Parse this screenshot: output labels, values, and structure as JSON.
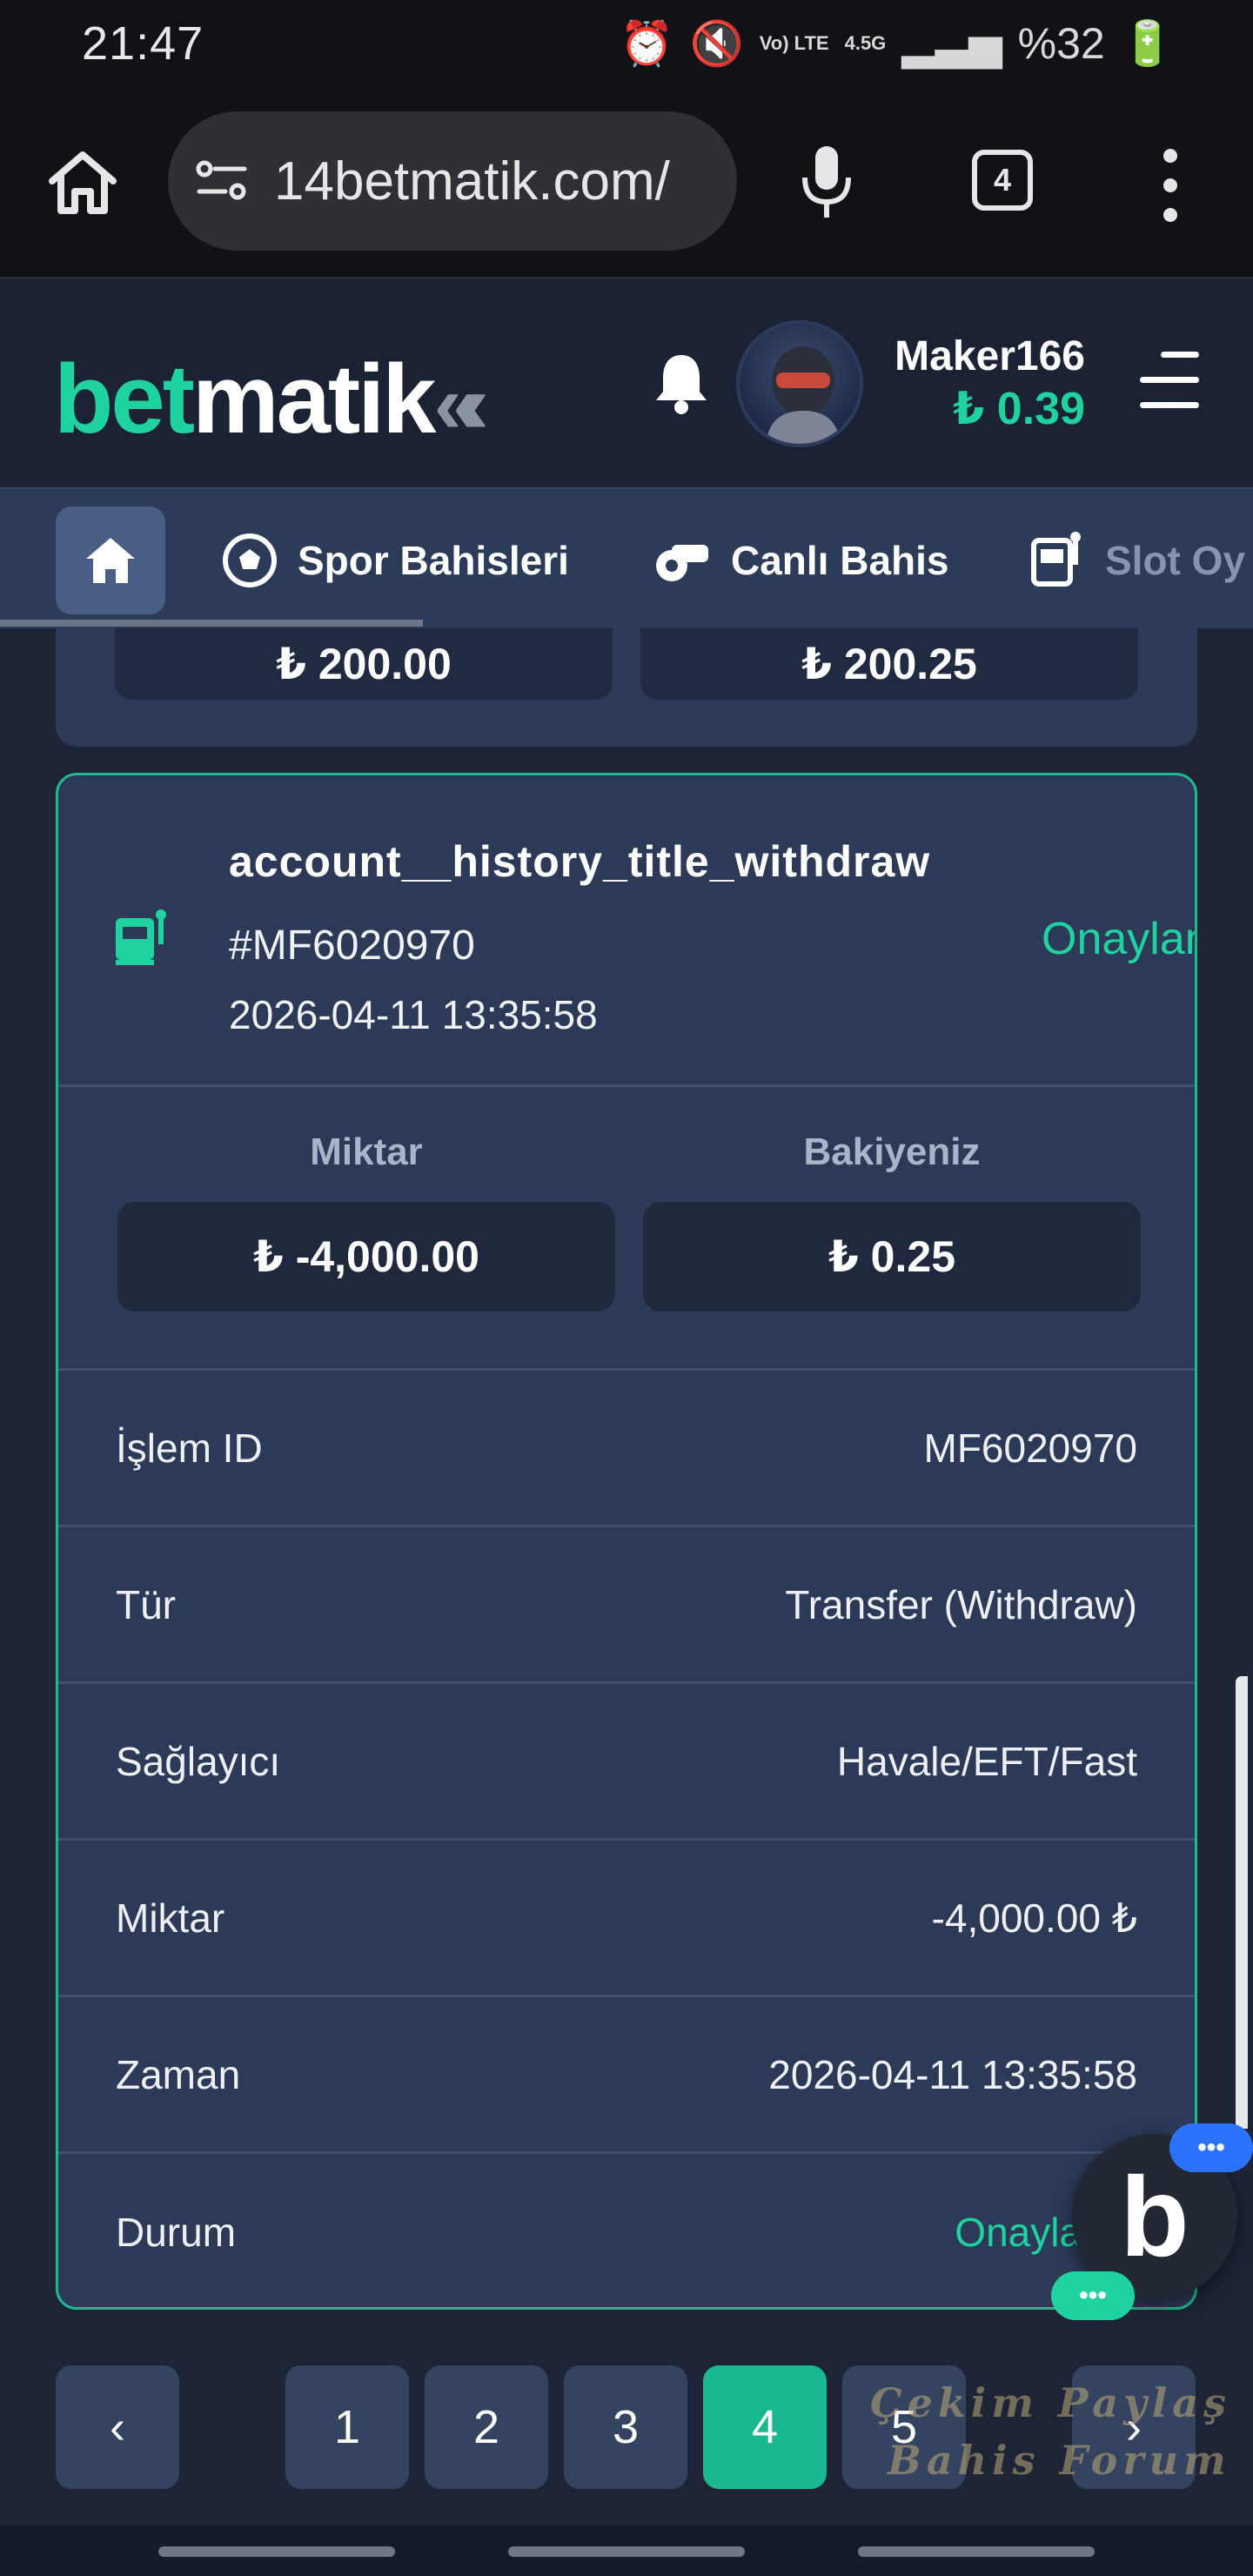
{
  "status_bar": {
    "time": "21:47",
    "network_top": "Vo) LTE",
    "network_speed": "4.5G",
    "battery": "%32"
  },
  "browser": {
    "url": "14betmatik.com/",
    "tab_count": "4"
  },
  "header": {
    "logo_bet": "bet",
    "logo_matik": "matik",
    "username": "Maker166",
    "balance": "₺ 0.39"
  },
  "nav": {
    "items": [
      {
        "label": "Spor Bahisleri"
      },
      {
        "label": "Canlı Bahis"
      },
      {
        "label": "Slot Oy"
      }
    ]
  },
  "previous_card": {
    "left_value": "₺ 200.00",
    "right_value": "₺ 200.25"
  },
  "transaction": {
    "title": "account__history_title_withdraw",
    "ref": "#MF6020970",
    "date": "2026-04-11 13:35:58",
    "status": "Onaylandı",
    "amount_label": "Miktar",
    "amount_value": "₺ -4,000.00",
    "balance_label": "Bakiyeniz",
    "balance_value": "₺ 0.25",
    "details": [
      {
        "key": "İşlem ID",
        "value": "MF6020970"
      },
      {
        "key": "Tür",
        "value": "Transfer (Withdraw)"
      },
      {
        "key": "Sağlayıcı",
        "value": "Havale/EFT/Fast"
      },
      {
        "key": "Miktar",
        "value": "-4,000.00 ₺"
      },
      {
        "key": "Zaman",
        "value": "2026-04-11 13:35:58"
      },
      {
        "key": "Durum",
        "value": "Onaylandı"
      }
    ]
  },
  "chat": {
    "badge_letter": "b",
    "dots": "•••"
  },
  "pagination": {
    "prev": "‹",
    "next": "›",
    "pages": [
      "1",
      "2",
      "3",
      "4",
      "5"
    ],
    "current": "4"
  },
  "watermark": {
    "line1": "Çekim Paylaş",
    "line2": "Bahis Forum"
  },
  "colors": {
    "accent": "#1fd3a0",
    "card_bg": "#2c3a58",
    "page_bg": "#1c2436",
    "active_page": "#1ab88f"
  }
}
